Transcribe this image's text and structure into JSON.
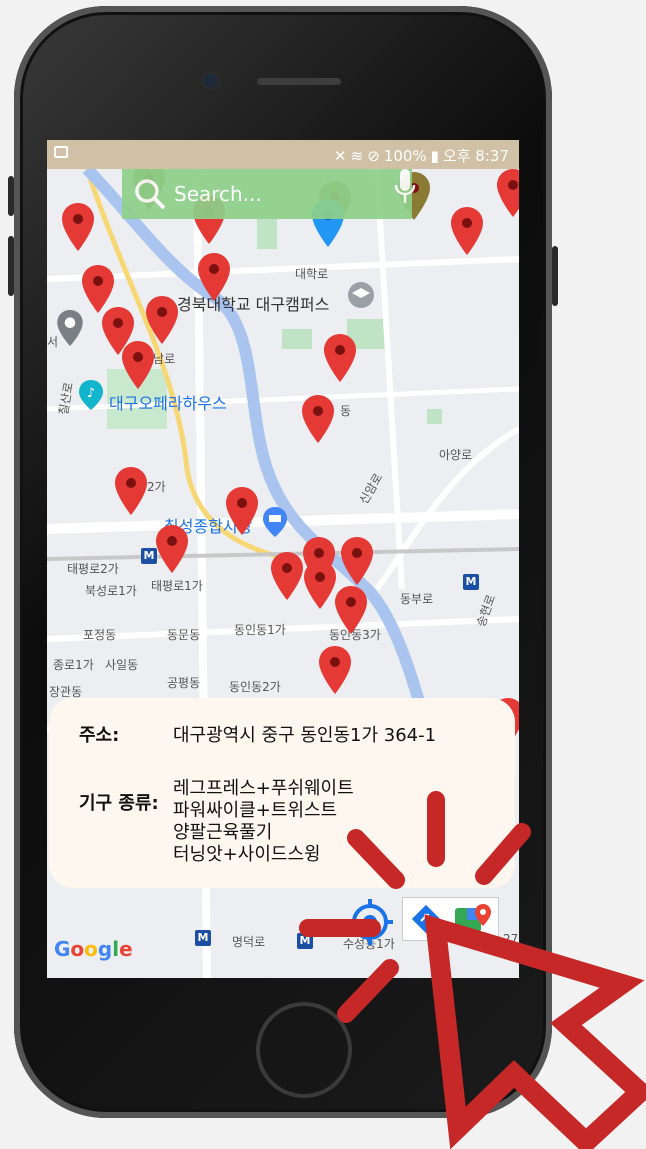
{
  "status": {
    "battery": "100%",
    "time": "오후 8:37"
  },
  "search": {
    "placeholder": "Search..."
  },
  "map_labels": {
    "university": "경북대학교 대구캠퍼스",
    "opera": "대구오페라하우스",
    "market": "칠성종합시장",
    "sanroad": "산남로",
    "daehakro": "대학로",
    "ayangro": "아양로",
    "sinamro": "신암로",
    "taepyeong2": "태평로2가",
    "bukseong1": "북성로1가",
    "taepyeong1": "태평로1가",
    "pojeong": "포정동",
    "dongmun": "동문동",
    "dongin1": "동인동1가",
    "dongin3": "동인동3가",
    "dongbu": "동부로",
    "jongno1": "종로1가",
    "sail": "사일동",
    "gongpyeong": "공평동",
    "dongin2": "동인동2가",
    "jangwan": "장관동",
    "myeongdeok": "명덕로",
    "suseong1": "수성동1가",
    "dong": "동",
    "ga2": "2가",
    "seo": "서",
    "cheol": "칠산로",
    "num27": "27",
    "songhyeon": "송현로"
  },
  "card": {
    "address_label": "주소:",
    "address_value": "대구광역시 중구 동인동1가 364-1",
    "equipment_label": "기구 종류:",
    "equipment": [
      "레그프레스+푸쉬웨이트",
      "파워싸이클+트위스트",
      "양팔근육풀기",
      "터닝앗+사이드스윙"
    ]
  },
  "google_logo": {
    "g1": "G",
    "o1": "o",
    "o2": "o",
    "g2": "g",
    "l": "l",
    "e": "e"
  },
  "metro_letter": "M",
  "colors": {
    "status_bar": "#cfc0a6",
    "search_bar": "#8ed08a",
    "pin_red": "#e53935",
    "pin_blue": "#2196f3",
    "river": "#aac4f0",
    "card_bg": "#fdf7f0",
    "cursor_red": "#c62828"
  }
}
